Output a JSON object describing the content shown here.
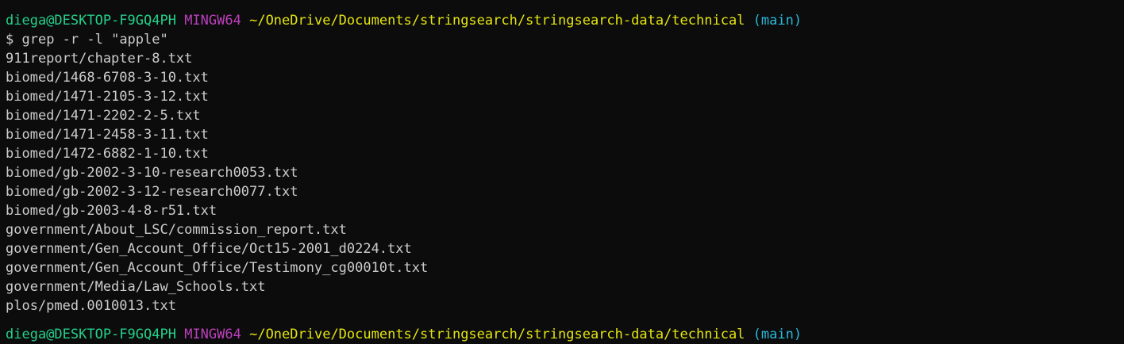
{
  "prompt": {
    "user_host": "diega@DESKTOP-F9GQ4PH",
    "system": "MINGW64",
    "path": "~/OneDrive/Documents/stringsearch/stringsearch-data/technical",
    "branch": "(main)"
  },
  "command": {
    "symbol": "$",
    "text": "grep -r -l \"apple\""
  },
  "output": [
    "911report/chapter-8.txt",
    "biomed/1468-6708-3-10.txt",
    "biomed/1471-2105-3-12.txt",
    "biomed/1471-2202-2-5.txt",
    "biomed/1471-2458-3-11.txt",
    "biomed/1472-6882-1-10.txt",
    "biomed/gb-2002-3-10-research0053.txt",
    "biomed/gb-2002-3-12-research0077.txt",
    "biomed/gb-2003-4-8-r51.txt",
    "government/About_LSC/commission_report.txt",
    "government/Gen_Account_Office/Oct15-2001_d0224.txt",
    "government/Gen_Account_Office/Testimony_cg00010t.txt",
    "government/Media/Law_Schools.txt",
    "plos/pmed.0010013.txt"
  ],
  "colors": {
    "background": "#0c0c0c",
    "text": "#cccccc",
    "user_host": "#23d18b",
    "system": "#bc3fbc",
    "path": "#e5e510",
    "branch": "#29b8db"
  }
}
